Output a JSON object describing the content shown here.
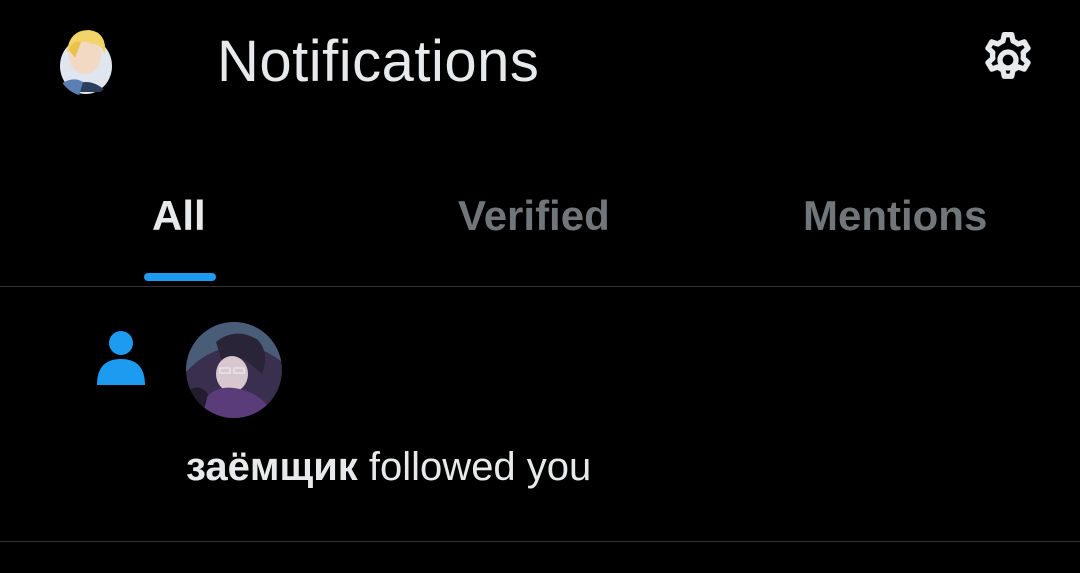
{
  "header": {
    "title": "Notifications",
    "avatar_icon": "user-avatar",
    "settings_icon": "gear-icon"
  },
  "tabs": [
    {
      "label": "All",
      "active": true
    },
    {
      "label": "Verified",
      "active": false
    },
    {
      "label": "Mentions",
      "active": false
    }
  ],
  "notifications": [
    {
      "type": "follow",
      "icon": "person-icon",
      "user": "заёмщик",
      "action": "followed you"
    }
  ],
  "colors": {
    "background": "#000000",
    "text_primary": "#e7e9ea",
    "text_secondary": "#71767b",
    "accent": "#1d9bf0",
    "divider": "#2f3336"
  }
}
